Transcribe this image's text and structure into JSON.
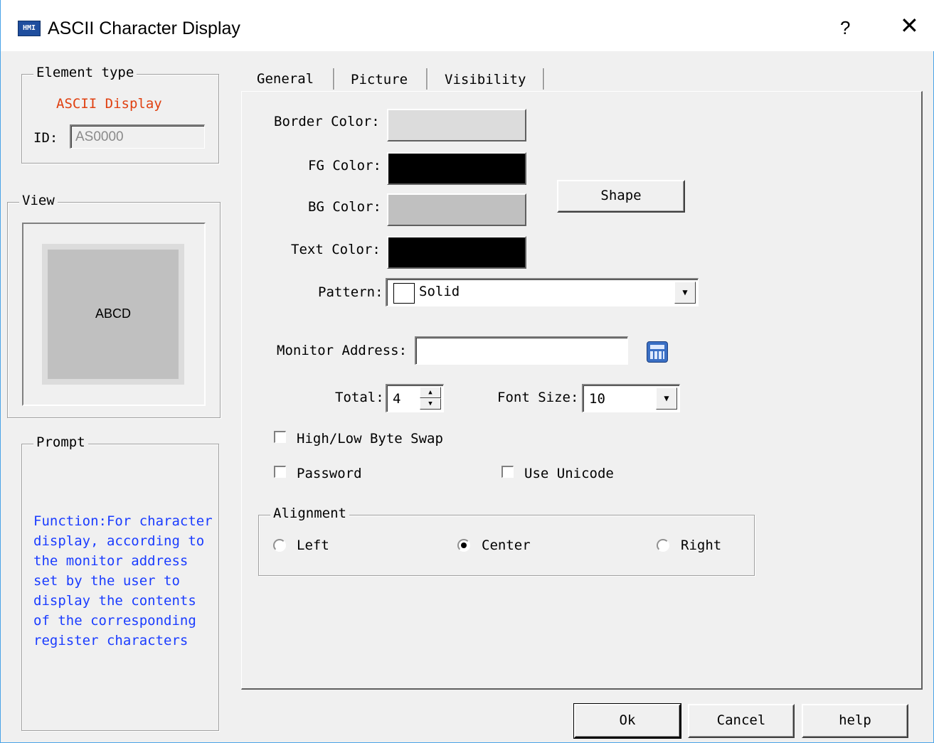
{
  "window": {
    "title": "ASCII Character Display",
    "help_glyph": "?",
    "close_glyph": "✕",
    "icon_text": "HMI"
  },
  "element_type": {
    "legend": "Element type",
    "type_name": "ASCII Display",
    "type_color": "#e04010",
    "id_label": "ID:",
    "id_value": "AS0000"
  },
  "view": {
    "legend": "View",
    "preview_text": "ABCD",
    "preview_bg": "#c0c0c0"
  },
  "prompt": {
    "legend": "Prompt",
    "text": "Function:For character display, according to the monitor address set by the user to display the contents of the corresponding register characters",
    "text_color": "#1a3cff"
  },
  "tabs": [
    {
      "label": "General",
      "active": true
    },
    {
      "label": "Picture",
      "active": false
    },
    {
      "label": "Visibility",
      "active": false
    }
  ],
  "general": {
    "border_color_label": "Border Color:",
    "border_color": "#dcdcdc",
    "fg_color_label": "FG Color:",
    "fg_color": "#000000",
    "bg_color_label": "BG Color:",
    "bg_color": "#c0c0c0",
    "text_color_label": "Text Color:",
    "text_color": "#000000",
    "shape_button": "Shape",
    "pattern_label": "Pattern:",
    "pattern_value": "Solid",
    "monitor_address_label": "Monitor Address:",
    "monitor_address_value": "",
    "total_label": "Total:",
    "total_value": "4",
    "font_size_label": "Font Size:",
    "font_size_value": "10",
    "high_low_swap_label": "High/Low Byte Swap",
    "high_low_swap_checked": false,
    "password_label": "Password",
    "password_checked": false,
    "use_unicode_label": "Use Unicode",
    "use_unicode_checked": false,
    "alignment_legend": "Alignment",
    "alignment_options": [
      "Left",
      "Center",
      "Right"
    ],
    "alignment_selected": "Center"
  },
  "footer": {
    "ok": "Ok",
    "cancel": "Cancel",
    "help": "help"
  }
}
